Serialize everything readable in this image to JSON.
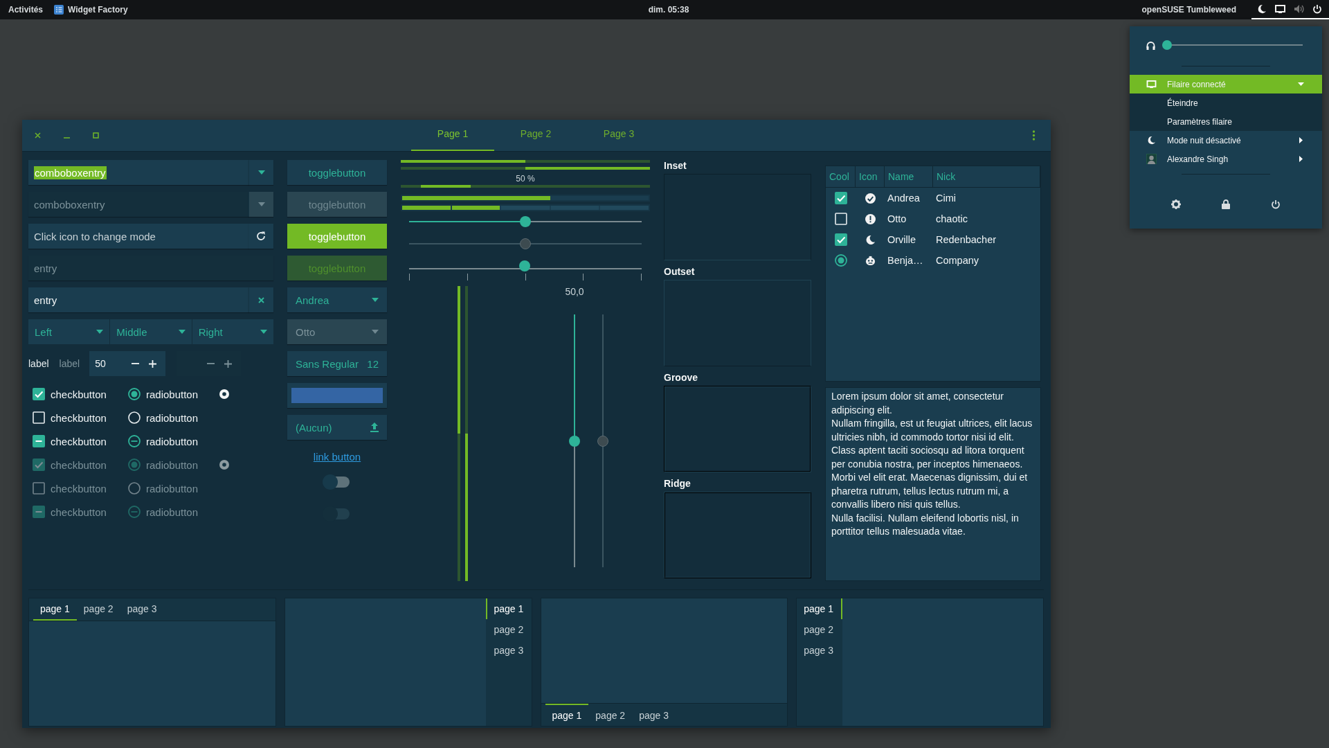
{
  "top_bar": {
    "activities": "Activités",
    "app_name": "Widget Factory",
    "clock": "dim. 05:38",
    "distro": "openSUSE Tumbleweed"
  },
  "system_menu": {
    "volume": {
      "level": 0
    },
    "items": [
      {
        "kind": "network",
        "label": "Filaire connecté",
        "selected": true,
        "expanded": true
      },
      {
        "kind": "subitem",
        "label": "Éteindre"
      },
      {
        "kind": "subitem",
        "label": "Paramètres filaire"
      },
      {
        "kind": "night",
        "label": "Mode nuit désactivé"
      },
      {
        "kind": "user",
        "label": "Alexandre Singh"
      }
    ]
  },
  "window": {
    "tabs": [
      {
        "label": "Page 1",
        "selected": true
      },
      {
        "label": "Page 2",
        "selected": false
      },
      {
        "label": "Page 3",
        "selected": false
      }
    ]
  },
  "entries": [
    {
      "kind": "combo",
      "value": "comboboxentry",
      "text_selected": true,
      "disabled": false
    },
    {
      "kind": "combo",
      "value": "comboboxentry",
      "text_selected": false,
      "disabled": true
    },
    {
      "kind": "icon",
      "placeholder": "Click icon to change mode",
      "disabled": false
    },
    {
      "kind": "plain",
      "value": "entry",
      "disabled": true
    },
    {
      "kind": "clear",
      "value": "entry",
      "disabled": false
    }
  ],
  "linked_combos": [
    "Left",
    "Middle",
    "Right"
  ],
  "labels": [
    {
      "text": "label",
      "disabled": false
    },
    {
      "text": "label",
      "disabled": true
    }
  ],
  "spin_buttons": [
    {
      "value": "50",
      "disabled": false
    },
    {
      "disabled": true
    }
  ],
  "check_rows": [
    {
      "check": {
        "label": "checkbutton",
        "checked": true,
        "mixed": false
      },
      "radio": {
        "label": "radiobutton",
        "checked": true,
        "mixed": false
      },
      "bare_radio": true,
      "disabled": false
    },
    {
      "check": {
        "label": "checkbutton",
        "checked": false,
        "mixed": false
      },
      "radio": {
        "label": "radiobutton",
        "checked": false,
        "mixed": false
      },
      "bare_radio": false,
      "disabled": false
    },
    {
      "check": {
        "label": "checkbutton",
        "mixed": true
      },
      "radio": {
        "label": "radiobutton",
        "mixed": true
      },
      "bare_radio": false,
      "disabled": false
    },
    {
      "check": {
        "label": "checkbutton",
        "checked": true,
        "mixed": false
      },
      "radio": {
        "label": "radiobutton",
        "checked": true,
        "mixed": false
      },
      "bare_radio": true,
      "disabled": true
    },
    {
      "check": {
        "label": "checkbutton",
        "checked": false,
        "mixed": false
      },
      "radio": {
        "label": "radiobutton",
        "checked": false,
        "mixed": false
      },
      "bare_radio": false,
      "disabled": true
    },
    {
      "check": {
        "label": "checkbutton",
        "mixed": true
      },
      "radio": {
        "label": "radiobutton",
        "mixed": true
      },
      "bare_radio": false,
      "disabled": true
    }
  ],
  "toggle_buttons": [
    {
      "label": "togglebutton",
      "active": false,
      "disabled": false
    },
    {
      "label": "togglebutton",
      "active": false,
      "disabled": true
    },
    {
      "label": "togglebutton",
      "active": true,
      "disabled": false
    },
    {
      "label": "togglebutton",
      "active": true,
      "disabled": true
    }
  ],
  "combo_boxes": [
    {
      "value": "Andrea",
      "disabled": false
    },
    {
      "value": "Otto",
      "disabled": true
    }
  ],
  "font_button": {
    "family": "Sans Regular",
    "size": "12"
  },
  "file_button": {
    "label": "(Aucun)"
  },
  "link_button": {
    "label": "link button"
  },
  "switches": [
    {
      "on": false,
      "disabled": false
    },
    {
      "on": false,
      "disabled": true
    }
  ],
  "progress_bars": [
    {
      "kind": "normal",
      "level": 0.5
    },
    {
      "kind": "inverted",
      "level": 0.5
    },
    {
      "kind": "pulse",
      "text": "50 %",
      "level": 0.2
    }
  ],
  "level_bars": [
    {
      "kind": "continuous",
      "level": 0.6
    },
    {
      "kind": "discrete",
      "level": 0.4
    }
  ],
  "scales": [
    {
      "level": 0.5,
      "disabled": false,
      "marks": false
    },
    {
      "level": 0.5,
      "disabled": true,
      "marks": false
    },
    {
      "level": 0.5,
      "disabled": false,
      "marks": true
    }
  ],
  "vertical_progress": [
    {
      "kind": "inverted",
      "level": 0.5
    },
    {
      "kind": "normal",
      "level": 0.5
    }
  ],
  "vertical_scales": [
    {
      "level": 0.5,
      "disabled": false,
      "value": "50,0"
    },
    {
      "level": 0.5,
      "disabled": true
    }
  ],
  "frames": [
    {
      "label": "Inset",
      "kind": "inset"
    },
    {
      "label": "Outset",
      "kind": "outset"
    },
    {
      "label": "Groove",
      "kind": "groove"
    },
    {
      "label": "Ridge",
      "kind": "ridge"
    }
  ],
  "tree": {
    "columns": [
      "Cool",
      "Icon",
      "Name",
      "Nick"
    ],
    "rows": [
      {
        "kind": "check",
        "checked": true,
        "name": "Andrea",
        "nick": "Cimi"
      },
      {
        "kind": "check",
        "checked": false,
        "name": "Otto",
        "nick": "chaotic"
      },
      {
        "kind": "check",
        "checked": true,
        "name": "Orville",
        "nick": "Redenbacher"
      },
      {
        "kind": "radio",
        "checked": true,
        "name": "Benja…",
        "nick": "Company"
      }
    ]
  },
  "text_view": {
    "paragraphs": [
      "Lorem ipsum dolor sit amet, consectetur adipiscing elit.",
      "Nullam fringilla, est ut feugiat ultrices, elit lacus ultricies nibh, id commodo tortor nisi id elit.",
      "Class aptent taciti sociosqu ad litora torquent per conubia nostra, per inceptos himenaeos.",
      "Morbi vel elit erat. Maecenas dignissim, dui et pharetra rutrum, tellus lectus rutrum mi, a convallis libero nisi quis tellus.",
      "Nulla facilisi. Nullam eleifend lobortis nisl, in porttitor tellus malesuada vitae."
    ]
  },
  "notebooks": [
    {
      "kind": "top",
      "tabs": [
        {
          "label": "page 1",
          "selected": true
        },
        {
          "label": "page 2",
          "selected": false
        },
        {
          "label": "page 3",
          "selected": false
        }
      ]
    },
    {
      "kind": "right",
      "tabs": [
        {
          "label": "page 1",
          "selected": true
        },
        {
          "label": "page 2",
          "selected": false
        },
        {
          "label": "page 3",
          "selected": false
        }
      ]
    },
    {
      "kind": "bottom",
      "tabs": [
        {
          "label": "page 1",
          "selected": true
        },
        {
          "label": "page 2",
          "selected": false
        },
        {
          "label": "page 3",
          "selected": false
        }
      ]
    },
    {
      "kind": "left",
      "tabs": [
        {
          "label": "page 1",
          "selected": true
        },
        {
          "label": "page 2",
          "selected": false
        },
        {
          "label": "page 3",
          "selected": false
        }
      ]
    }
  ]
}
